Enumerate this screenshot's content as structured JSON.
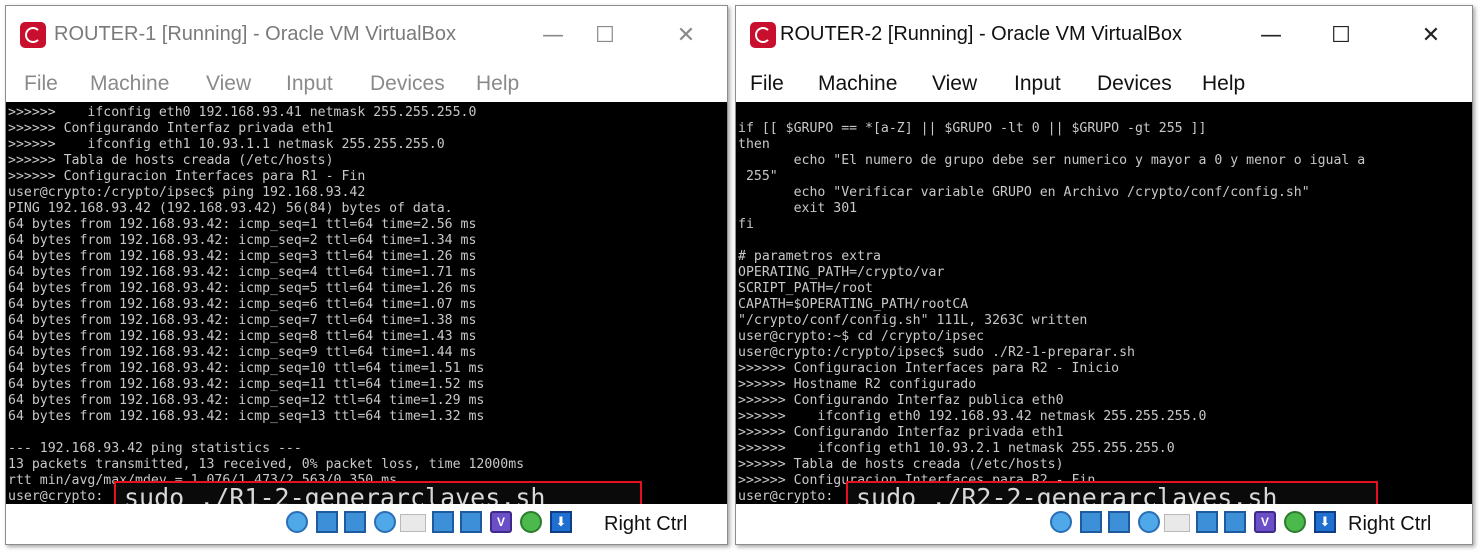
{
  "windows": [
    {
      "title": "ROUTER-1 [Running] - Oracle VM VirtualBox",
      "controls": {
        "minimize": "—",
        "maximize": "☐",
        "close": "✕"
      },
      "menu": [
        "File",
        "Machine",
        "View",
        "Input",
        "Devices",
        "Help"
      ],
      "console_lines": [
        ">>>>>>    ifconfig eth0 192.168.93.41 netmask 255.255.255.0",
        ">>>>>> Configurando Interfaz privada eth1",
        ">>>>>>    ifconfig eth1 10.93.1.1 netmask 255.255.255.0",
        ">>>>>> Tabla de hosts creada (/etc/hosts)",
        ">>>>>> Configuracion Interfaces para R1 - Fin",
        "user@crypto:/crypto/ipsec$ ping 192.168.93.42",
        "PING 192.168.93.42 (192.168.93.42) 56(84) bytes of data.",
        "64 bytes from 192.168.93.42: icmp_seq=1 ttl=64 time=2.56 ms",
        "64 bytes from 192.168.93.42: icmp_seq=2 ttl=64 time=1.34 ms",
        "64 bytes from 192.168.93.42: icmp_seq=3 ttl=64 time=1.26 ms",
        "64 bytes from 192.168.93.42: icmp_seq=4 ttl=64 time=1.71 ms",
        "64 bytes from 192.168.93.42: icmp_seq=5 ttl=64 time=1.26 ms",
        "64 bytes from 192.168.93.42: icmp_seq=6 ttl=64 time=1.07 ms",
        "64 bytes from 192.168.93.42: icmp_seq=7 ttl=64 time=1.38 ms",
        "64 bytes from 192.168.93.42: icmp_seq=8 ttl=64 time=1.43 ms",
        "64 bytes from 192.168.93.42: icmp_seq=9 ttl=64 time=1.44 ms",
        "64 bytes from 192.168.93.42: icmp_seq=10 ttl=64 time=1.51 ms",
        "64 bytes from 192.168.93.42: icmp_seq=11 ttl=64 time=1.52 ms",
        "64 bytes from 192.168.93.42: icmp_seq=12 ttl=64 time=1.29 ms",
        "64 bytes from 192.168.93.42: icmp_seq=13 ttl=64 time=1.32 ms",
        "",
        "--- 192.168.93.42 ping statistics ---",
        "13 packets transmitted, 13 received, 0% packet loss, time 12000ms",
        "rtt min/avg/max/mdev = 1.076/1.473/2.563/0.350 ms",
        "user@crypto:"
      ],
      "highlight_command": "sudo ./R1-2-generarclaves.sh",
      "host_key": "Right Ctrl"
    },
    {
      "title": "ROUTER-2 [Running] - Oracle VM VirtualBox",
      "controls": {
        "minimize": "—",
        "maximize": "☐",
        "close": "✕"
      },
      "menu": [
        "File",
        "Machine",
        "View",
        "Input",
        "Devices",
        "Help"
      ],
      "console_lines": [
        "if [[ $GRUPO == *[a-Z] || $GRUPO -lt 0 || $GRUPO -gt 255 ]]",
        "then",
        "       echo \"El numero de grupo debe ser numerico y mayor a 0 y menor o igual a",
        " 255\"",
        "       echo \"Verificar variable GRUPO en Archivo /crypto/conf/config.sh\"",
        "       exit 301",
        "fi",
        "",
        "# parametros extra",
        "OPERATING_PATH=/crypto/var",
        "SCRIPT_PATH=/root",
        "CAPATH=$OPERATING_PATH/rootCA",
        "\"/crypto/conf/config.sh\" 111L, 3263C written",
        "user@crypto:~$ cd /crypto/ipsec",
        "user@crypto:/crypto/ipsec$ sudo ./R2-1-preparar.sh",
        ">>>>>> Configuracion Interfaces para R2 - Inicio",
        ">>>>>> Hostname R2 configurado",
        ">>>>>> Configurando Interfaz publica eth0",
        ">>>>>>    ifconfig eth0 192.168.93.42 netmask 255.255.255.0",
        ">>>>>> Configurando Interfaz privada eth1",
        ">>>>>>    ifconfig eth1 10.93.2.1 netmask 255.255.255.0",
        ">>>>>> Tabla de hosts creada (/etc/hosts)",
        ">>>>>> Configuracion Interfaces para R2 - Fin",
        "user@crypto:"
      ],
      "highlight_command": "sudo ./R2-2-generarclaves.sh",
      "host_key": "Right Ctrl"
    }
  ],
  "status_icons": [
    "optical-drive-icon",
    "audio-icon",
    "network-icon",
    "usb-icon",
    "shared-folder-icon",
    "display-icon",
    "recording-icon",
    "virtualization-icon",
    "mouse-integration-icon",
    "keyboard-capture-icon"
  ]
}
